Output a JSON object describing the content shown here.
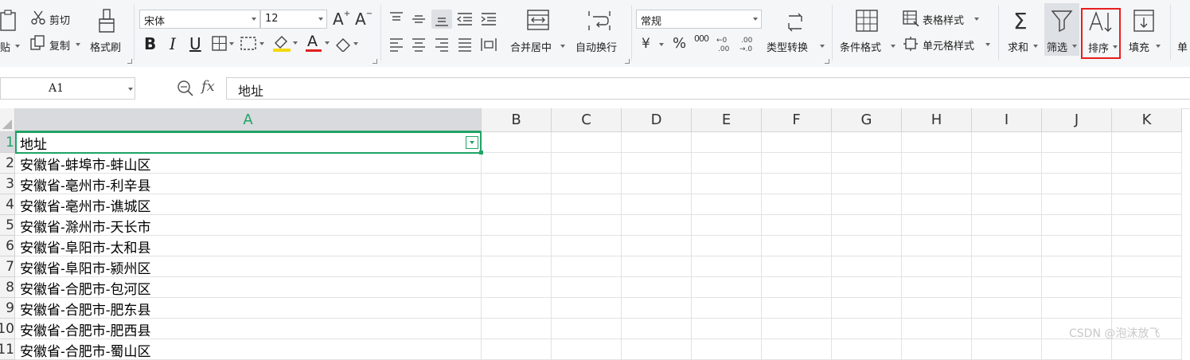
{
  "ribbon": {
    "clipboard": {
      "paste_label": "粘贴",
      "cut_label": "剪切",
      "copy_label": "复制",
      "format_painter_label": "格式刷"
    },
    "font": {
      "name": "宋体",
      "size": "12",
      "bold": "B",
      "italic": "I",
      "underline": "U",
      "font_color_glyph": "A"
    },
    "alignment": {
      "merge_label": "合并居中",
      "wrap_label": "自动换行"
    },
    "number": {
      "format": "常规",
      "currency_glyph": "¥",
      "percent_glyph": "%",
      "thousands_glyph": "000",
      "convert_label": "类型转换"
    },
    "styles": {
      "conditional_label": "条件格式",
      "table_style_label": "表格样式",
      "cell_style_label": "单元格样式"
    },
    "editing": {
      "sum_label": "求和",
      "filter_label": "筛选",
      "sort_label": "排序",
      "fill_label": "填充",
      "next_label": "单"
    },
    "colors": {
      "highlight_yellow": "#f5d90a",
      "font_red": "#e02020",
      "sort_box_red": "#e81e1e",
      "selection_green": "#21a366"
    }
  },
  "formula_bar": {
    "name_box": "A1",
    "fx": "fx",
    "content": "地址"
  },
  "grid": {
    "columns": [
      "A",
      "B",
      "C",
      "D",
      "E",
      "F",
      "G",
      "H",
      "I",
      "J",
      "K"
    ],
    "rows": [
      {
        "num": "1",
        "a": "地址"
      },
      {
        "num": "2",
        "a": "安徽省-蚌埠市-蚌山区"
      },
      {
        "num": "3",
        "a": "安徽省-亳州市-利辛县"
      },
      {
        "num": "4",
        "a": "安徽省-亳州市-谯城区"
      },
      {
        "num": "5",
        "a": "安徽省-滁州市-天长市"
      },
      {
        "num": "6",
        "a": "安徽省-阜阳市-太和县"
      },
      {
        "num": "7",
        "a": "安徽省-阜阳市-颍州区"
      },
      {
        "num": "8",
        "a": "安徽省-合肥市-包河区"
      },
      {
        "num": "9",
        "a": "安徽省-合肥市-肥东县"
      },
      {
        "num": "10",
        "a": "安徽省-合肥市-肥西县"
      },
      {
        "num": "11",
        "a": "安徽省-合肥市-蜀山区"
      }
    ]
  },
  "watermark": "CSDN @泡沫放飞"
}
